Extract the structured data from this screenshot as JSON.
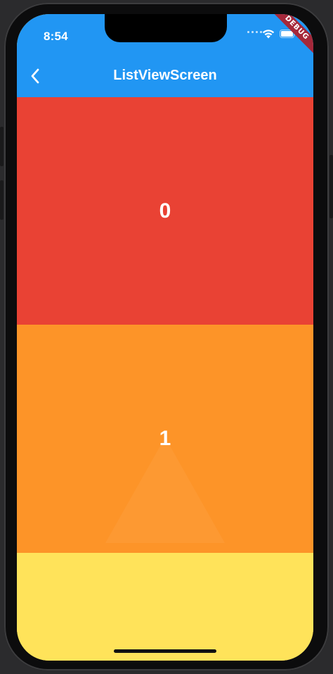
{
  "status_bar": {
    "time": "8:54"
  },
  "debug_banner": {
    "label": "DEBUG",
    "color": "#a5283a"
  },
  "app_bar": {
    "title": "ListViewScreen",
    "back_icon": "chevron-left-icon",
    "color": "#2196f3"
  },
  "list": {
    "items": [
      {
        "label": "0",
        "color": "#e94234"
      },
      {
        "label": "1",
        "color": "#fd9428"
      },
      {
        "label": "",
        "color": "#ffe35a"
      }
    ]
  }
}
